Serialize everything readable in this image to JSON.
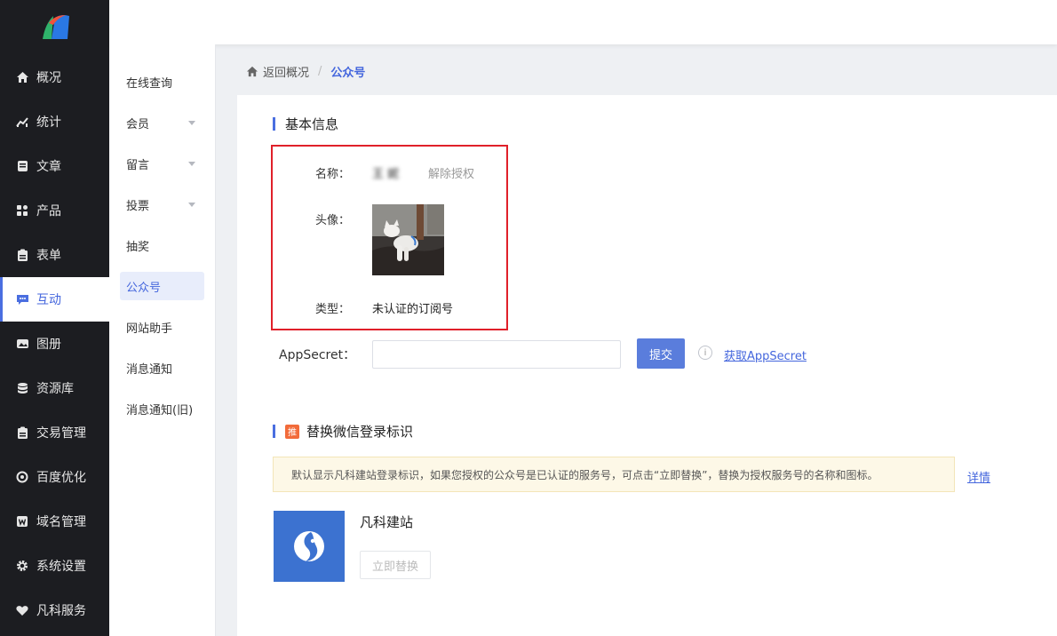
{
  "nav": {
    "items": [
      {
        "label": "概况",
        "icon": "home-icon"
      },
      {
        "label": "统计",
        "icon": "chart-icon"
      },
      {
        "label": "文章",
        "icon": "article-icon"
      },
      {
        "label": "产品",
        "icon": "grid-icon"
      },
      {
        "label": "表单",
        "icon": "clipboard-icon"
      },
      {
        "label": "互动",
        "icon": "chat-icon"
      },
      {
        "label": "图册",
        "icon": "image-icon"
      },
      {
        "label": "资源库",
        "icon": "database-icon"
      },
      {
        "label": "交易管理",
        "icon": "clipboard-icon"
      },
      {
        "label": "百度优化",
        "icon": "target-icon"
      },
      {
        "label": "域名管理",
        "icon": "w-icon"
      },
      {
        "label": "系统设置",
        "icon": "gear-icon"
      },
      {
        "label": "凡科服务",
        "icon": "heart-icon"
      }
    ],
    "active_index": 5
  },
  "subnav": {
    "items": [
      {
        "label": "在线查询",
        "dropdown": false
      },
      {
        "label": "会员",
        "dropdown": true
      },
      {
        "label": "留言",
        "dropdown": true
      },
      {
        "label": "投票",
        "dropdown": true
      },
      {
        "label": "抽奖",
        "dropdown": false
      },
      {
        "label": "公众号",
        "dropdown": false
      },
      {
        "label": "网站助手",
        "dropdown": false
      },
      {
        "label": "消息通知",
        "dropdown": false
      },
      {
        "label": "消息通知(旧)",
        "dropdown": false
      }
    ],
    "active_index": 5
  },
  "breadcrumb": {
    "back": "返回概况",
    "sep": "/",
    "current": "公众号"
  },
  "basic_info": {
    "title": "基本信息",
    "name_label": "名称：",
    "name_value": "王 妮",
    "unauthorize": "解除授权",
    "avatar_label": "头像：",
    "type_label": "类型：",
    "type_value": "未认证的订阅号"
  },
  "appsecret": {
    "label": "AppSecret：",
    "value": "",
    "placeholder": "",
    "submit": "提交",
    "info": "i",
    "link": "获取AppSecret"
  },
  "replace": {
    "badge": "推",
    "title": "替换微信登录标识",
    "notice": "默认显示凡科建站登录标识，如果您授权的公众号是已认证的服务号，可点击“立即替换”，替换为授权服务号的名称和图标。",
    "details": "详情",
    "brand_name": "凡科建站",
    "replace_button": "立即替换"
  },
  "colors": {
    "accent": "#4466dd",
    "sidebar_bg": "#1c1d21",
    "highlight_red": "#e0202a",
    "badge_orange": "#f26b3a"
  }
}
